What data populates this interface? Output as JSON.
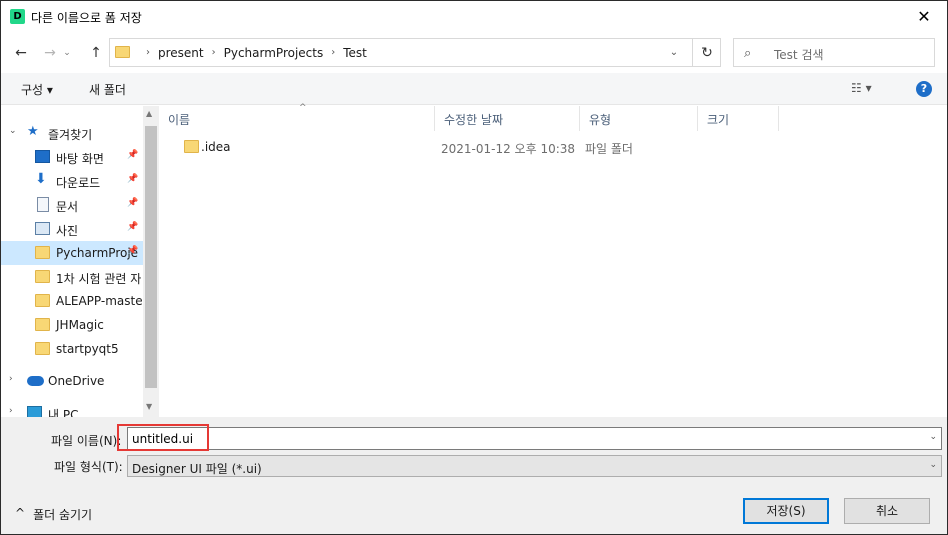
{
  "window": {
    "app_icon_letter": "D",
    "title": "다른 이름으로 폼 저장",
    "close_glyph": "✕"
  },
  "nav": {
    "back_icon": "←",
    "forward_icon": "→",
    "recent_icon": "⌄",
    "up_icon": "↑",
    "breadcrumb": [
      "present",
      "PycharmProjects",
      "Test"
    ],
    "crumb_sep": "›",
    "dropdown_icon": "⌄",
    "refresh_icon": "↻",
    "search_icon": "⌕",
    "search_placeholder": "Test 검색"
  },
  "toolbar": {
    "organize_label": "구성 ▾",
    "new_folder_label": "새 폴더",
    "view_icon": "☷ ▾",
    "help_label": "?"
  },
  "navpane": {
    "quick_access": "즐겨찾기",
    "items": [
      {
        "label": "바탕 화면",
        "icon": "desktop-icon",
        "pinned": true
      },
      {
        "label": "다운로드",
        "icon": "download-icon",
        "pinned": true
      },
      {
        "label": "문서",
        "icon": "document-icon",
        "pinned": true
      },
      {
        "label": "사진",
        "icon": "pictures-icon",
        "pinned": true
      },
      {
        "label": "PycharmProje",
        "icon": "folder-icon",
        "pinned": true,
        "selected": true
      },
      {
        "label": "1차 시험 관련 자",
        "icon": "folder-icon",
        "pinned": false
      },
      {
        "label": "ALEAPP-master",
        "icon": "folder-icon",
        "pinned": false
      },
      {
        "label": "JHMagic",
        "icon": "folder-icon",
        "pinned": false
      },
      {
        "label": "startpyqt5",
        "icon": "folder-icon",
        "pinned": false
      }
    ],
    "onedrive": "OneDrive",
    "this_pc": "내 PC",
    "pin_glyph": "📌",
    "expand_glyph": "›",
    "expanded_glyph": "⌄"
  },
  "filepane": {
    "columns": [
      "이름",
      "수정한 날짜",
      "유형",
      "크기"
    ],
    "sort_caret": "^",
    "rows": [
      {
        "name": ".idea",
        "date": "2021-01-12 오후 10:38",
        "type": "파일 폴더",
        "size": ""
      }
    ]
  },
  "bottom": {
    "filename_label": "파일 이름(N):",
    "filename_value": "untitled.ui",
    "filetype_label": "파일 형식(T):",
    "filetype_value": "Designer UI 파일 (*.ui)",
    "hide_folders_label": "폴더 숨기기",
    "hide_folders_icon": "^",
    "save_label": "저장(S)",
    "cancel_label": "취소",
    "caret": "⌄"
  },
  "colors": {
    "selected_bg": "#cce8ff",
    "highlight_border": "#e53935",
    "primary_button_border": "#0078d7",
    "app_icon": "#21d789",
    "help_icon": "#1e6ec8"
  }
}
